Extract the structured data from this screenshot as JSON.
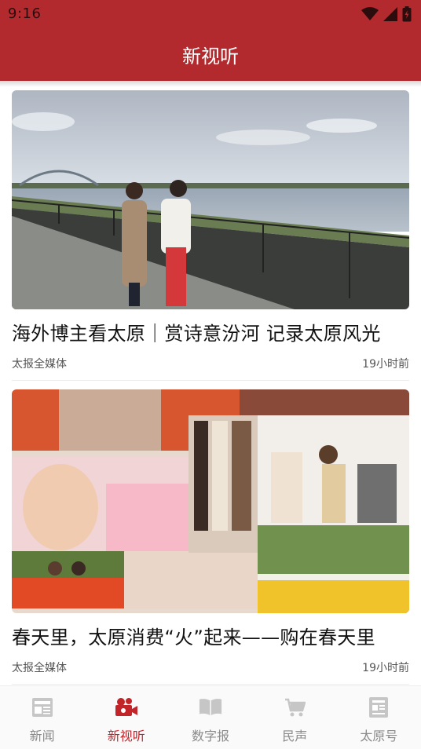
{
  "status_bar": {
    "time": "9:16",
    "icons": [
      "wifi-icon",
      "cellular-signal-icon",
      "battery-icon"
    ]
  },
  "header": {
    "title": "新视听",
    "background_color": "#b22a2e"
  },
  "feed": [
    {
      "title": "海外博主看太原｜赏诗意汾河  记录太原风光",
      "source": "太报全媒体",
      "time": "19小时前",
      "image": "video-thumbnail"
    },
    {
      "title": "春天里，太原消费“火”起来——购在春天里",
      "source": "太报全媒体",
      "time": "19小时前",
      "image": "video-thumbnail"
    }
  ],
  "bottom_nav": {
    "items": [
      {
        "label": "新闻",
        "icon": "newspaper-icon",
        "active": false
      },
      {
        "label": "新视听",
        "icon": "video-camera-icon",
        "active": true
      },
      {
        "label": "数字报",
        "icon": "open-book-icon",
        "active": false
      },
      {
        "label": "民声",
        "icon": "shopping-cart-icon",
        "active": false
      },
      {
        "label": "太原号",
        "icon": "document-icon",
        "active": false
      }
    ],
    "active_color": "#c2242a",
    "inactive_color": "#8a8a8a"
  }
}
